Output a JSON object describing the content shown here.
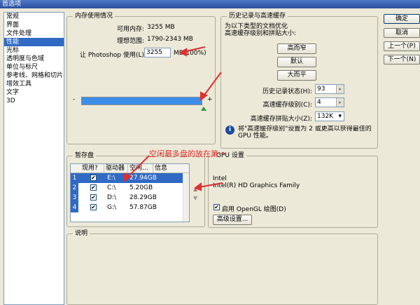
{
  "window": {
    "title": "首选项"
  },
  "categories": [
    {
      "label": "常规"
    },
    {
      "label": "界面"
    },
    {
      "label": "文件处理"
    },
    {
      "label": "性能"
    },
    {
      "label": "光标"
    },
    {
      "label": "透明度与色域"
    },
    {
      "label": "单位与标尺"
    },
    {
      "label": "参考线、网格和切片"
    },
    {
      "label": "增效工具"
    },
    {
      "label": "文字"
    },
    {
      "label": "3D"
    }
  ],
  "selected_category": 3,
  "memory": {
    "legend": "内存使用情况",
    "available_label": "可用内存:",
    "available_value": "3255 MB",
    "ideal_label": "理想范围:",
    "ideal_value": "1790-2343 MB",
    "let_label": "让 Photoshop 使用(L):",
    "let_value": "3255",
    "unit_percent": "MB(100%)",
    "slider_min": "-",
    "slider_max": "+",
    "slider_level_percent": 100
  },
  "history": {
    "legend": "历史记录与高速缓存",
    "desc": "为以下类型的文档优化\n高速缓存级别和拼贴大小:",
    "btn_tall": "高而窄",
    "btn_default": "默认",
    "btn_flat": "大而平",
    "states_label": "历史记录状态(H):",
    "states_value": "93",
    "levels_label": "高速缓存级别(C):",
    "levels_value": "4",
    "tile_label": "高速缓存拼贴大小(Z):",
    "tile_value": "132K",
    "info_text": "将\"高速缓存级别\"设置为 2 或更高以获得最佳的\nGPU 性能。"
  },
  "scratch": {
    "legend": "暂存盘",
    "columns": [
      "现用?",
      "驱动器",
      "空闲...",
      "信息"
    ],
    "rows": [
      {
        "num": "1",
        "drive": "E:\\",
        "free": "27.94GB",
        "checked": "✔"
      },
      {
        "num": "2",
        "drive": "C:\\",
        "free": "5.20GB",
        "checked": "✔"
      },
      {
        "num": "3",
        "drive": "D:\\",
        "free": "28.29GB",
        "checked": "✔"
      },
      {
        "num": "4",
        "drive": "G:\\",
        "free": "57.87GB",
        "checked": "✔"
      }
    ]
  },
  "gpu": {
    "legend": "GPU 设置",
    "vendor": "Intel",
    "card": "Intel(R) HD Graphics Family",
    "opengl_label": "启用 OpenGL 绘图(D)",
    "advanced": "高级设置..."
  },
  "description": {
    "legend": "说明"
  },
  "buttons": {
    "ok": "确定",
    "cancel": "取消",
    "prev": "上一个(P)",
    "next": "下一个(N)"
  },
  "annotation": "空闲最多盘的放在第一",
  "colors": {
    "accent": "#316ac5",
    "annotation": "#e12e2e",
    "slider": "#3d8ee9"
  }
}
